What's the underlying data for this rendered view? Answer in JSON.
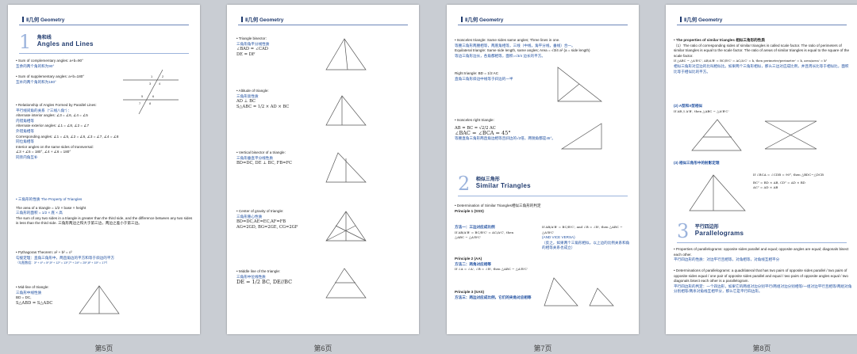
{
  "header": "Ⅱ几何 Geometry",
  "pages": [
    {
      "label": "第5页",
      "section": {
        "num": "1",
        "cn": "角和线",
        "en": "Angles and Lines"
      },
      "comp": "• Sum of complementary angles:  a+b=90°",
      "comp_cn": "互余的两个角的和为90°",
      "supp": "• Sum of supplementary angles:  a+b=180°",
      "supp_cn": "互补的两个角的和为180°",
      "rel": "• Relationship of Angles Formed by Parallel Lines:",
      "rel_cn": "平行线间角的关系（“三线八角”）：",
      "alt_int": "Alternate interior angles:  ∠3 = ∠6, ∠4 = ∠5",
      "alt_int_cn": "内错角相等",
      "alt_ext": "Alternate exterior angles:  ∠1 = ∠8, ∠2 = ∠7",
      "alt_ext_cn": "外错角相等",
      "corr": "Corresponding angles:  ∠1 = ∠5, ∠2 = ∠6, ∠3 = ∠7, ∠4 = ∠8",
      "corr_cn": "同位角相等",
      "int_same": "Interior angles on the same sides of transversal:",
      "int_same_f": "∠3 + ∠5 = 180°, ∠4 + ∠6 = 180°",
      "int_same_cn": "同旁内角互补",
      "tri_title": "• 三角形的性质 The Property of Triangles",
      "tri_area": "The area of a triangle = 1/2 × base × height",
      "tri_area_cn": "三角形的面积 = 1/2 × 底 × 高",
      "tri_side": "The sum of any two sides in a triangle is greater than the third side, and the difference between any two sides is less than the third side. 三角形两边之和大于第三边，两边之差小于第三边。",
      "pyth": "• Pythagoras Theorem:  a² + b² = c²",
      "pyth_cn": "勾股定理：直角三角形中，两直角边的平方和等于斜边的平方",
      "pyth_ex": "（勾股数组：3² + 4² = 5²,5² + 12² = 13²,7² + 24² = 25²,8² + 15² = 17²）",
      "mid": "• Mid-line of triangle:",
      "mid_cn": "三角形中线性质",
      "mid_bd": "BD = DC,",
      "mid_s": "S△ABD = S△ADC",
      "fig": {
        "l1": "1",
        "l2": "2",
        "l3": "3",
        "l4": "4",
        "l5": "5",
        "l6": "6",
        "l7": "7",
        "l8": "8"
      }
    },
    {
      "label": "第6页",
      "bis": "• Triangle bisector:",
      "bis_cn": "三角形角平分线性质",
      "bis_f1": "∠BAD = ∠CAD",
      "bis_f2": "DE = DF",
      "alt": "• Altitude of triangle:",
      "alt_cn": "三角形高性质",
      "alt_f1": "AD ⊥ BC",
      "alt_f2": "S△ABC = 1/2 × AD × BC",
      "vb": "• Vertical bisector of a triangle:",
      "vb_cn": "三角形垂直平分线性质",
      "vb_f": "BD=DC, DE ⊥ BC, FB=FC",
      "cg": "• Center of gravity of triangle:",
      "cg_cn": "三角形重心性质",
      "cg_f1": "BD=DC,AE=EC,AF=FB",
      "cg_f2": "AG=2GD, BG=2GE, CG=2GF",
      "ml": "• Middle line of the triangle:",
      "ml_cn": "三角形中位线性质",
      "ml_f": "DE = 1/2 BC, DE//BC"
    },
    {
      "label": "第7页",
      "iso": "• Isosceles triangle: Same sides same angles; Three lines in one.",
      "iso_cn": "等腰三角形两腰相等，两底角相等，三线（中线，角平分线，垂线）合一。",
      "equi": "Equilateral triangle: Same side length, same angles; Area = √3/4 a² (a = side length)",
      "equi_cn": "等边三角形边长，各角都相等，面积=√3/4 边长的平方。",
      "right": "Right triangle: BD = 1/2 AC",
      "right_cn": "直角三角形斜边中线等于斜边的一半",
      "irt": "• Isosceles right triangle:",
      "irt_f1": "AB = BC = √2/2 AC",
      "irt_f2": "∠BAC = ∠BCA = 45°",
      "irt_cn": "等腰直角三角形两直角边相等且斜边的√2倍，两锐角都是45°。",
      "section": {
        "num": "2",
        "cn": "相似三角形",
        "en": "Similar Triangles"
      },
      "det": "• Determination of Similar Triangles相似三角形的判定",
      "p1": "Principle 1 (SSS)",
      "m1": "方法一：三边对应成比例",
      "m1_f": "If AB/A'B' = BC/B'C' = AC/A'C', then △ABC ∼ △A'B'C'",
      "m1_b": "If AB/A'B' = BC/B'C', and ∠B = ∠B', then △ABC ∼ △A'B'C'",
      "m1_c": "(AND VICE VERSA)",
      "m1_d": "（反之，如果两个三角形相似，以上边的比例关系和角的相等关系也成立）",
      "p2": "Principle 2 (AA)",
      "m2": "方法二：两角对应相等",
      "m2_f": "If ∠A = ∠A', ∠B = ∠B', then △ABC ∼ △A'B'C'",
      "p3": "Principle 3 (SAS)",
      "m3": "方法三：两边对应成比例，它们的夹角对应相等"
    },
    {
      "label": "第8页",
      "sim": "• The properties of similar triangles 相似三角形的性质",
      "sim1": "（1）The ratio of corresponding sides of similar triangles is called scale factor. The ratio of perimeters of similar triangles is equal to the scale factor. The ratio of areas of similar triangles is equal to the square of the scale factor.",
      "sim1_f": "If △ABC ∼ △A'B'C', AB/A'B' = BC/B'C' = AC/A'C' = k, then perimeter/perimeter' = k, area/area' = k²",
      "sim1_cn": "相似三角形对应边的比叫相似比。如果两个三角形相似，那么三边对应成比例，并且周长比等于相似比，面积比等于相似比的平方。",
      "s2": "(2)  A型和X型相似",
      "s2_f": "If AB // A'B', then △ABC ∼ △A'B'C'",
      "s3": "(3)  相似三角形中的射影定理",
      "s3_f1": "If ∠BCA = ∠CDB = 90°, then △BDC∼△DCB",
      "s3_f2": "BC² = BD × AB, CD² = AD × BD",
      "s3_f3": "AC² = AD × AB",
      "section": {
        "num": "3",
        "cn": "平行四边形",
        "en": "Parallelograms"
      },
      "pp": "• Properties of parallelograms: opposite sides parallel and equal; opposite angles are equal; diagonals bisect each other.",
      "pp_cn": "平行四边形的性质：对边平行且相等，对角相等，对角线互相平分",
      "dp": "• Determinations of parallelograms: a quadrilateral that has two pairs of opposite sides parallel / two pairs of opposite sides equal / one pair of opposite sides parallel and equal / two pairs of opposite angles equal / two diagonals bisect each other is a parallelogram.",
      "dp_cn": "平行四边形的判定：一个四边形，如果它的两组对边分别平行/两组对边分别相等/一组对边平行且相等/两组对角分别相等/两条对角线互相平分，那么它是平行四边形。"
    }
  ]
}
